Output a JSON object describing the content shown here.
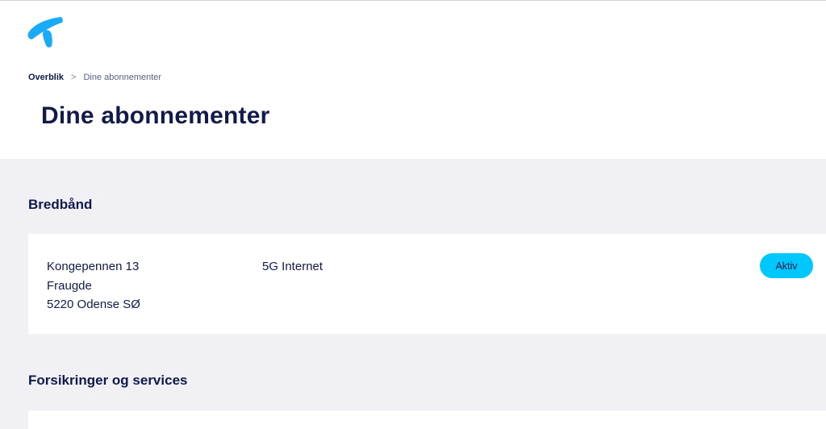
{
  "brand": {
    "logo_icon": "telenor-logo-icon",
    "accent_color": "#00c8ff"
  },
  "breadcrumb": {
    "items": [
      "Overblik",
      "Dine abonnementer"
    ],
    "separator": ">"
  },
  "page": {
    "title": "Dine abonnementer"
  },
  "sections": {
    "bredband": {
      "title": "Bredbånd",
      "subscription": {
        "address_line1": "Kongepennen 13",
        "address_line2": "Fraugde",
        "address_line3": "5220 Odense SØ",
        "product": "5G Internet",
        "status": "Aktiv"
      }
    },
    "forsikringer": {
      "title": "Forsikringer og services"
    }
  }
}
